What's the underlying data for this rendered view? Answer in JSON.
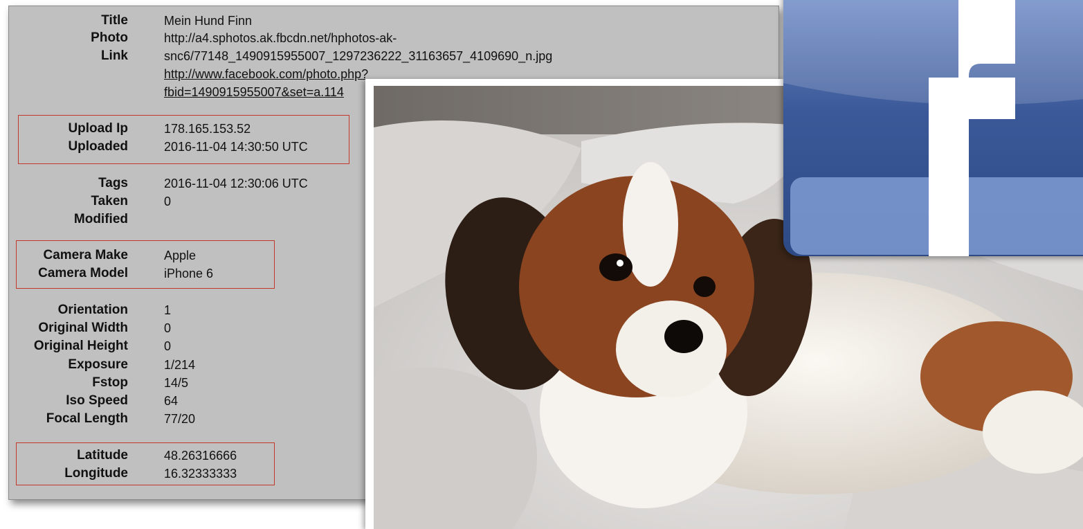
{
  "metadata": {
    "title_label": "Title",
    "title_value": "Mein Hund Finn",
    "photo_label": "Photo",
    "link_label": "Link",
    "photo_url_line1": "http://a4.sphotos.ak.fbcdn.net/hphotos-ak-",
    "photo_url_line2": "snc6/77148_1490915955007_1297236222_31163657_4109690_n.jpg",
    "link_url_line1": "http://www.facebook.com/photo.php?",
    "link_url_line2": "fbid=1490915955007&set=a.114",
    "upload_ip_label": "Upload Ip",
    "upload_ip_value": "178.165.153.52",
    "uploaded_label": "Uploaded",
    "uploaded_value": "2016-11-04 14:30:50 UTC",
    "tags_label": "Tags",
    "tags_value": "2016-11-04 12:30:06 UTC",
    "taken_label": "Taken",
    "taken_value": "0",
    "modified_label": "Modified",
    "camera_make_label": "Camera Make",
    "camera_make_value": "Apple",
    "camera_model_label": "Camera Model",
    "camera_model_value": "iPhone 6",
    "orientation_label": "Orientation",
    "orientation_value": "1",
    "original_width_label": "Original Width",
    "original_width_value": "0",
    "original_height_label": "Original Height",
    "original_height_value": "0",
    "exposure_label": "Exposure",
    "exposure_value": "1/214",
    "fstop_label": "Fstop",
    "fstop_value": "14/5",
    "iso_label": "Iso Speed",
    "iso_value": "64",
    "focal_label": "Focal Length",
    "focal_value": "77/20",
    "latitude_label": "Latitude",
    "latitude_value": "48.26316666",
    "longitude_label": "Longitude",
    "longitude_value": "16.32333333"
  },
  "logo": {
    "letter": "f",
    "brand_color": "#3b5998"
  },
  "colors": {
    "panel_bg": "#c0c0c0",
    "highlight_border": "#c0392b"
  }
}
